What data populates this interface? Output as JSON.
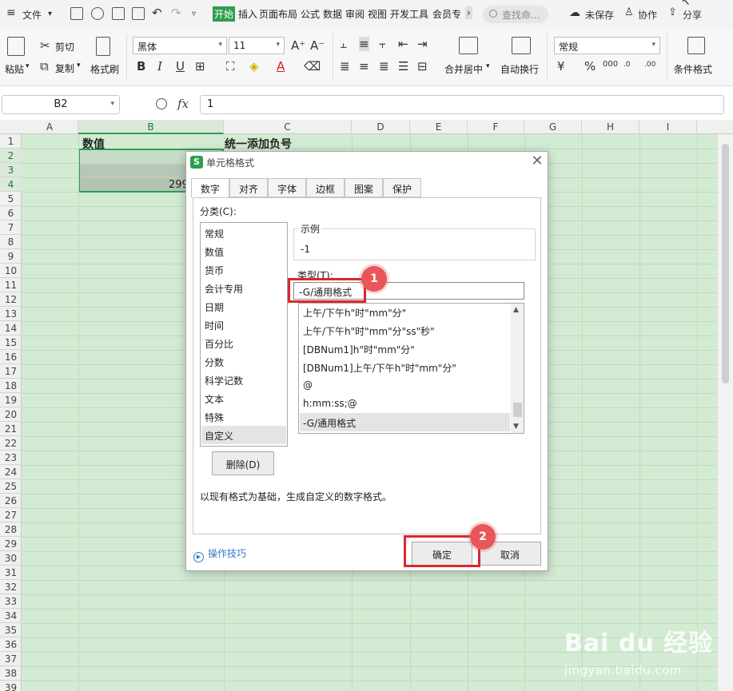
{
  "menubar": {
    "file_label": "文件",
    "tabs": [
      "开始",
      "插入",
      "页面布局",
      "公式",
      "数据",
      "审阅",
      "视图",
      "开发工具",
      "会员专"
    ],
    "active_tab": "开始",
    "search_placeholder": "查找命...",
    "unsaved_label": "未保存",
    "collab_label": "协作",
    "share_label": "分享"
  },
  "ribbon": {
    "paste_label": "粘贴",
    "cut_label": "剪切",
    "copy_label": "复制",
    "format_painter_label": "格式刷",
    "font_name": "黑体",
    "font_size": "11",
    "merge_center_label": "合并居中",
    "wrap_label": "自动换行",
    "number_format": "常规",
    "conditional_format_label": "条件格式"
  },
  "formula_bar": {
    "name_box": "B2",
    "fx": "fx",
    "value": "1"
  },
  "grid": {
    "columns": [
      "A",
      "B",
      "C",
      "D",
      "E",
      "F",
      "G",
      "H",
      "I"
    ],
    "selected_column": "B",
    "rows": [
      "1",
      "2",
      "3",
      "4",
      "5",
      "6",
      "7",
      "8",
      "9",
      "10",
      "11",
      "12",
      "13",
      "14",
      "15",
      "16",
      "17",
      "18",
      "19",
      "20",
      "21",
      "22",
      "23",
      "24",
      "25",
      "26",
      "27",
      "28",
      "29",
      "30",
      "31",
      "32",
      "33",
      "34",
      "35",
      "36",
      "37",
      "38",
      "39"
    ],
    "selected_rows": [
      "2",
      "3",
      "4"
    ],
    "cells": {
      "B1": "数值",
      "C1": "统一添加负号",
      "B4": "299"
    }
  },
  "dialog": {
    "title": "单元格格式",
    "tabs": [
      "数字",
      "对齐",
      "字体",
      "边框",
      "图案",
      "保护"
    ],
    "active_tab": "数字",
    "category_label": "分类(C):",
    "categories": [
      "常规",
      "数值",
      "货币",
      "会计专用",
      "日期",
      "时间",
      "百分比",
      "分数",
      "科学记数",
      "文本",
      "特殊",
      "自定义"
    ],
    "selected_category": "自定义",
    "delete_label": "删除(D)",
    "sample_label": "示例",
    "sample_value": "-1",
    "type_label": "类型(T):",
    "type_value": "-G/通用格式",
    "type_list": [
      "上午/下午h\"时\"mm\"分\"",
      "上午/下午h\"时\"mm\"分\"ss\"秒\"",
      "[DBNum1]h\"时\"mm\"分\"",
      "[DBNum1]上午/下午h\"时\"mm\"分\"",
      "@",
      "h:mm:ss;@",
      "-G/通用格式"
    ],
    "selected_type": "-G/通用格式",
    "hint": "以现有格式为基础，生成自定义的数字格式。",
    "tips_label": "操作技巧",
    "ok_label": "确定",
    "cancel_label": "取消"
  },
  "annotations": {
    "badge_1": "1",
    "badge_2": "2"
  },
  "watermark": {
    "brand": "Bai du 经验",
    "url": "jingyan.baidu.com"
  },
  "colors": {
    "accent_green": "#2e9e4f",
    "grid_bg": "#d3ebd3",
    "annotation_red": "#d9282e",
    "badge_red": "#e8565a",
    "link_blue": "#3478c6"
  }
}
